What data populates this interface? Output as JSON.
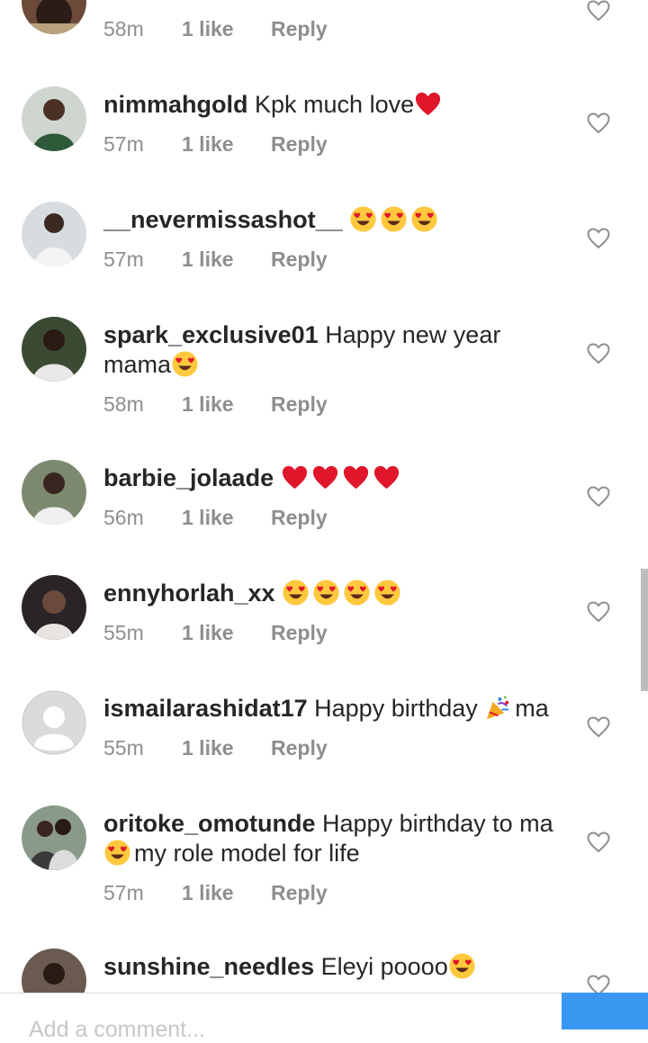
{
  "comments": [
    {
      "username": "",
      "text": "",
      "time": "58m",
      "likes": "1 like",
      "reply": "Reply",
      "avatar_color": "#5a3d32"
    },
    {
      "username": "nimmahgold",
      "text": "Kpk much love",
      "emoji": [
        "red-heart"
      ],
      "time": "57m",
      "likes": "1 like",
      "reply": "Reply",
      "avatar_color": "#2f5a3a"
    },
    {
      "username": "__nevermissashot__",
      "text": "",
      "emoji": [
        "heart-eyes",
        "heart-eyes",
        "heart-eyes"
      ],
      "time": "57m",
      "likes": "1 like",
      "reply": "Reply",
      "avatar_color": "#c9cdd2"
    },
    {
      "username": "spark_exclusive01",
      "text": "Happy new year mama",
      "emoji": [
        "heart-eyes"
      ],
      "time": "58m",
      "likes": "1 like",
      "reply": "Reply",
      "avatar_color": "#3b3b2a"
    },
    {
      "username": "barbie_jolaade",
      "text": "",
      "emoji": [
        "red-heart",
        "red-heart",
        "red-heart",
        "red-heart"
      ],
      "time": "56m",
      "likes": "1 like",
      "reply": "Reply",
      "avatar_color": "#8a8f7a"
    },
    {
      "username": "ennyhorlah_xx",
      "text": "",
      "emoji": [
        "heart-eyes",
        "heart-eyes",
        "heart-eyes",
        "heart-eyes"
      ],
      "time": "55m",
      "likes": "1 like",
      "reply": "Reply",
      "avatar_color": "#2a2426"
    },
    {
      "username": "ismailarashidat17",
      "text": "Happy birthday",
      "text_after": "ma",
      "emoji": [
        "party-popper"
      ],
      "time": "55m",
      "likes": "1 like",
      "reply": "Reply",
      "avatar_color": "#dbdbdb"
    },
    {
      "username": "oritoke_omotunde",
      "text": "Happy birthday to ma",
      "text_after": "my role model for life",
      "emoji": [
        "heart-eyes"
      ],
      "time": "57m",
      "likes": "1 like",
      "reply": "Reply",
      "avatar_color": "#4a4a4a"
    },
    {
      "username": "sunshine_needles",
      "text": "Eleyi poooo",
      "emoji": [
        "heart-eyes"
      ],
      "avatar_color": "#3a2a28"
    }
  ],
  "footer": {
    "placeholder": "Add a comment..."
  },
  "colors": {
    "meta_gray": "#8e8e8e",
    "accent": "#3897f0"
  }
}
